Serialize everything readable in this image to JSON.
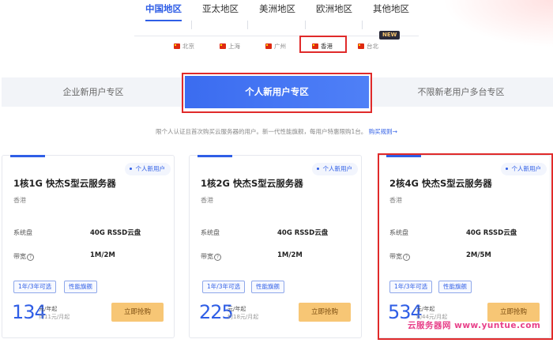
{
  "regions": {
    "tabs": [
      "中国地区",
      "亚太地区",
      "美洲地区",
      "欧洲地区",
      "其他地区"
    ],
    "active_index": 0,
    "new_badge": "NEW",
    "cities": [
      "北京",
      "上海",
      "广州",
      "香港",
      "台北"
    ],
    "selected_city": "香港"
  },
  "sections": {
    "tabs": [
      "企业新用户专区",
      "个人新用户专区",
      "不限新老用户多台专区"
    ],
    "active_index": 1
  },
  "notice": {
    "text": "限个人认证且首次购买云服务器的用户。新一代性能旗舰，每用户特惠限购1台。",
    "link": "购买规则→"
  },
  "cards": [
    {
      "tag": "个人新用户",
      "title": "1核1G 快杰S型云服务器",
      "region": "香港",
      "disk_label": "系统盘",
      "disk_value": "40G RSSD云盘",
      "bandwidth_label": "带宽",
      "bandwidth_value": "1M/2M",
      "chips": [
        "1年/3年可选",
        "性能旗舰"
      ],
      "price": "134",
      "price_unit": "元/年起",
      "price_month": "约11元/月起",
      "buy_label": "立即抢购"
    },
    {
      "tag": "个人新用户",
      "title": "1核2G 快杰S型云服务器",
      "region": "香港",
      "disk_label": "系统盘",
      "disk_value": "40G RSSD云盘",
      "bandwidth_label": "带宽",
      "bandwidth_value": "1M/2M",
      "chips": [
        "1年/3年可选",
        "性能旗舰"
      ],
      "price": "225",
      "price_unit": "元/年起",
      "price_month": "约18元/月起",
      "buy_label": "立即抢购"
    },
    {
      "tag": "个人新用户",
      "title": "2核4G 快杰S型云服务器",
      "region": "香港",
      "disk_label": "系统盘",
      "disk_value": "40G RSSD云盘",
      "bandwidth_label": "带宽",
      "bandwidth_value": "2M/5M",
      "chips": [
        "1年/3年可选",
        "性能旗舰"
      ],
      "price": "534",
      "price_unit": "元/年起",
      "price_month": "约44元/月起",
      "buy_label": "立即抢购"
    }
  ],
  "watermark": "云服务器网 www.yuntue.com",
  "colors": {
    "accent": "#2f5ee6",
    "highlight": "#e02a2a",
    "buy_button": "#f7c675"
  }
}
